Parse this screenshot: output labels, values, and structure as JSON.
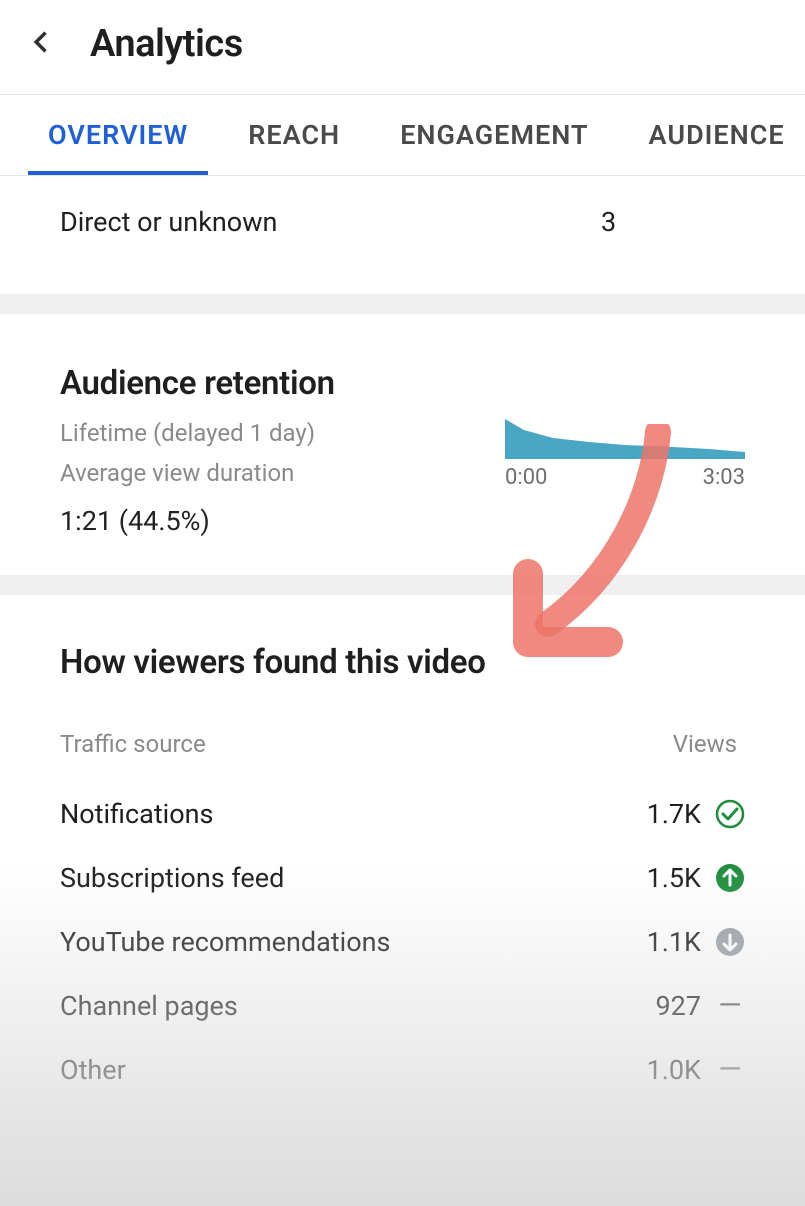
{
  "header": {
    "title": "Analytics"
  },
  "tabs": [
    "OVERVIEW",
    "REACH",
    "ENGAGEMENT",
    "AUDIENCE"
  ],
  "direct_row": {
    "label": "Direct or unknown",
    "value": "3"
  },
  "retention": {
    "title": "Audience retention",
    "subtitle": "Lifetime (delayed 1 day)",
    "avg_label": "Average view duration",
    "value": "1:21 (44.5%)",
    "time_start": "0:00",
    "time_end": "3:03"
  },
  "traffic": {
    "title": "How viewers found this video",
    "col_source": "Traffic source",
    "col_views": "Views",
    "rows": [
      {
        "label": "Notifications",
        "value": "1.7K",
        "badge": "check"
      },
      {
        "label": "Subscriptions feed",
        "value": "1.5K",
        "badge": "up"
      },
      {
        "label": "YouTube recommendations",
        "value": "1.1K",
        "badge": "down"
      },
      {
        "label": "Channel pages",
        "value": "927",
        "badge": "dash"
      },
      {
        "label": "Other",
        "value": "1.0K",
        "badge": "dash"
      }
    ]
  },
  "chart_data": {
    "type": "area",
    "title": "Audience retention",
    "xlabel": "",
    "ylabel": "",
    "xlim": [
      "0:00",
      "3:03"
    ],
    "ylim": [
      0,
      100
    ],
    "note": "y values are estimated retention % across normalized x positions 0..1",
    "x": [
      0.0,
      0.08,
      0.2,
      0.35,
      0.5,
      0.7,
      0.85,
      1.0
    ],
    "y": [
      100,
      72,
      52,
      42,
      36,
      30,
      24,
      18
    ]
  }
}
